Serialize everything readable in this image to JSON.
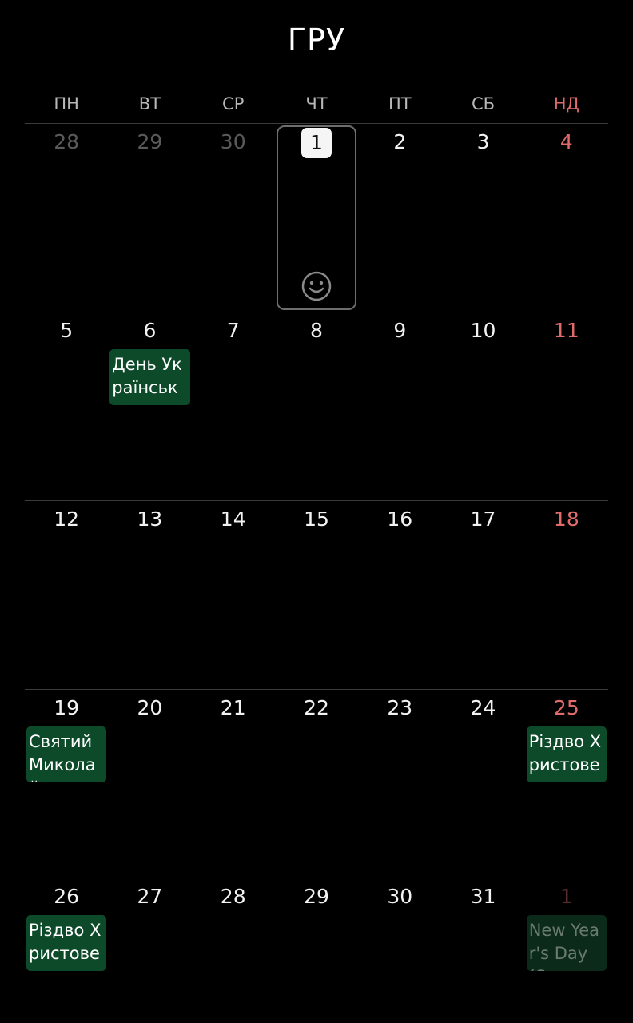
{
  "header": {
    "month_title": "ГРУ"
  },
  "weekdays": [
    "ПН",
    "ВТ",
    "СР",
    "ЧТ",
    "ПТ",
    "СБ",
    "НД"
  ],
  "weeks": [
    {
      "days": [
        {
          "num": "28",
          "muted": true
        },
        {
          "num": "29",
          "muted": true
        },
        {
          "num": "30",
          "muted": true
        },
        {
          "num": "1",
          "today": true
        },
        {
          "num": "2"
        },
        {
          "num": "3"
        },
        {
          "num": "4",
          "sunday": true
        }
      ]
    },
    {
      "days": [
        {
          "num": "5"
        },
        {
          "num": "6",
          "event": "День Українсько"
        },
        {
          "num": "7"
        },
        {
          "num": "8"
        },
        {
          "num": "9"
        },
        {
          "num": "10"
        },
        {
          "num": "11",
          "sunday": true
        }
      ]
    },
    {
      "days": [
        {
          "num": "12"
        },
        {
          "num": "13"
        },
        {
          "num": "14"
        },
        {
          "num": "15"
        },
        {
          "num": "16"
        },
        {
          "num": "17"
        },
        {
          "num": "18",
          "sunday": true
        }
      ]
    },
    {
      "days": [
        {
          "num": "19",
          "event": "Святий Миколай"
        },
        {
          "num": "20"
        },
        {
          "num": "21"
        },
        {
          "num": "22"
        },
        {
          "num": "23"
        },
        {
          "num": "24"
        },
        {
          "num": "25",
          "sunday": true,
          "event": "Різдво Христове"
        }
      ]
    },
    {
      "days": [
        {
          "num": "26",
          "event": "Різдво Христове"
        },
        {
          "num": "27"
        },
        {
          "num": "28"
        },
        {
          "num": "29"
        },
        {
          "num": "30"
        },
        {
          "num": "31"
        },
        {
          "num": "1",
          "sunday": true,
          "muted": true,
          "event": "New Year's Day (S",
          "event_faded": true
        }
      ]
    }
  ],
  "icons": {
    "today_indicator": "smiley-icon"
  },
  "colors": {
    "background": "#000000",
    "sunday": "#e06b6b",
    "event": "#0d4a2a",
    "grid_line": "#3b3b3b"
  }
}
